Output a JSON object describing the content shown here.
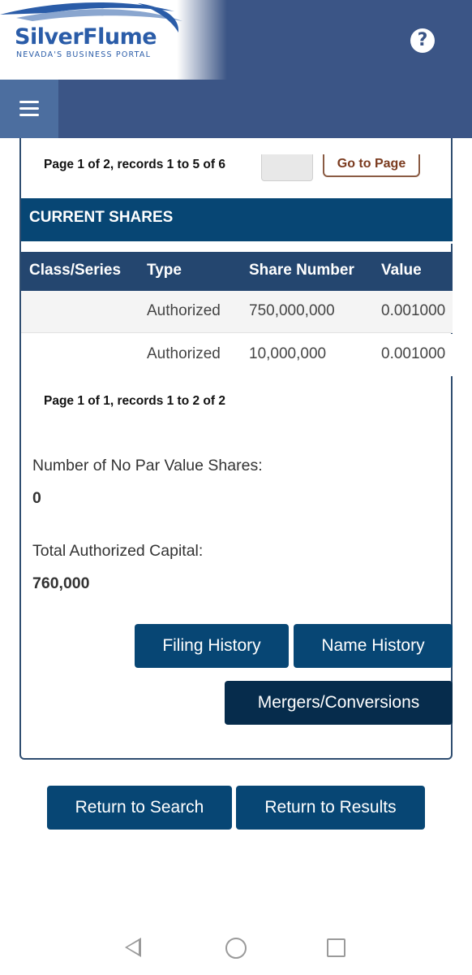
{
  "header": {
    "logo_title": "SilverFlume",
    "logo_subtitle": "NEVADA'S BUSINESS PORTAL",
    "help_glyph": "?",
    "help_icon": "question-circle-icon",
    "menu_icon": "hamburger-menu-icon"
  },
  "shares_card": {
    "pager_top": "Page 1 of 2, records 1 to 5 of 6",
    "page_input_value": "",
    "goto_label": "Go to Page",
    "section_title": "CURRENT SHARES",
    "columns": [
      "Class/Series",
      "Type",
      "Share Number",
      "Value"
    ],
    "rows": [
      [
        "",
        "Authorized",
        "750,000,000",
        "0.001000"
      ],
      [
        "",
        "Authorized",
        "10,000,000",
        "0.001000"
      ]
    ],
    "pager_bottom": "Page 1 of 1, records 1 to 2 of 2",
    "no_par_label": "Number of No Par Value Shares:",
    "no_par_value": "0",
    "capital_label": "Total Authorized Capital:",
    "capital_value": "760,000",
    "buttons": {
      "filing_history": "Filing History",
      "name_history": "Name History",
      "mergers": "Mergers/Conversions"
    }
  },
  "footer_buttons": {
    "return_search": "Return to Search",
    "return_results": "Return to Results"
  },
  "colors": {
    "header_bg": "#3b5586",
    "primary_button": "#074674",
    "dark_button": "#062c4c",
    "table_header": "#24466f",
    "logo_blue": "#2a5ca8"
  }
}
